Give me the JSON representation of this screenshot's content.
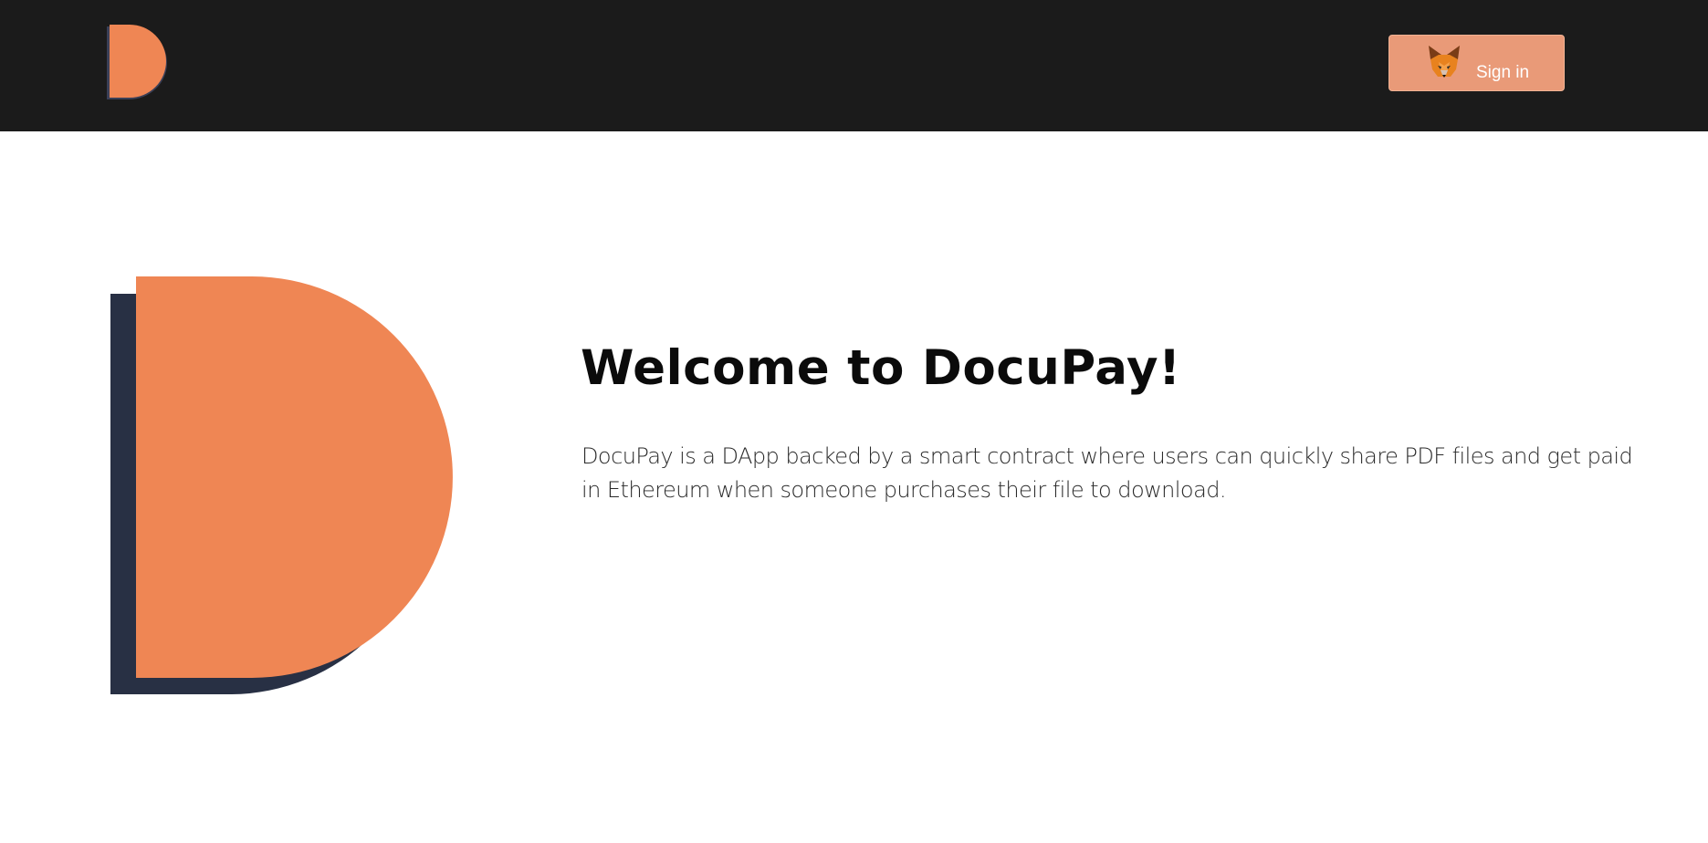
{
  "header": {
    "logo": {
      "icon": "docupay-d-logo-icon",
      "color": "#ef8654",
      "shadow_color": "#283044"
    },
    "signin": {
      "label": "Sign in",
      "icon": "metamask-fox-icon",
      "background": "#e99a78"
    },
    "background": "#1b1b1b"
  },
  "hero": {
    "logo": {
      "icon": "docupay-d-logo-icon",
      "color": "#ef8654",
      "shadow_color": "#283044"
    },
    "title": "Welcome to DocuPay!",
    "description": "DocuPay is a DApp backed by a smart contract where users can quickly share PDF files and get paid in Ethereum when someone purchases their file to download."
  }
}
